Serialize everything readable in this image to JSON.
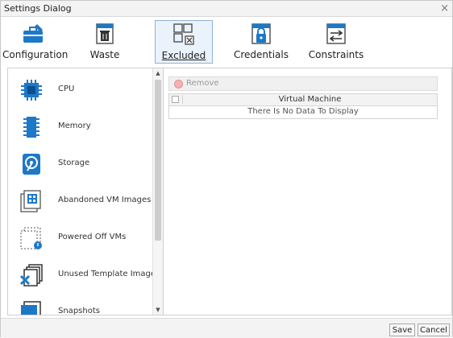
{
  "window": {
    "title": "Settings Dialog",
    "close_glyph": "×"
  },
  "toolbar": {
    "tabs": [
      {
        "label": "Configuration",
        "icon": "toolbox-icon"
      },
      {
        "label": "Waste",
        "icon": "trash-icon"
      },
      {
        "label": "Excluded",
        "icon": "excluded-grid-icon",
        "selected": true
      },
      {
        "label": "Credentials",
        "icon": "lock-icon"
      },
      {
        "label": "Constraints",
        "icon": "arrows-icon"
      }
    ]
  },
  "sidebar": {
    "items": [
      {
        "label": "CPU",
        "icon": "cpu-icon"
      },
      {
        "label": "Memory",
        "icon": "memory-icon"
      },
      {
        "label": "Storage",
        "icon": "storage-icon"
      },
      {
        "label": "Abandoned VM Images",
        "icon": "abandoned-images-icon"
      },
      {
        "label": "Powered Off VMs",
        "icon": "powered-off-icon"
      },
      {
        "label": "Unused Template Images",
        "icon": "unused-templates-icon"
      },
      {
        "label": "Snapshots",
        "icon": "snapshot-icon"
      }
    ]
  },
  "main": {
    "remove_label": "Remove",
    "grid": {
      "column": "Virtual Machine",
      "empty_text": "There Is No Data To Display"
    }
  },
  "footer": {
    "save_label": "Save",
    "cancel_label": "Cancel"
  },
  "colors": {
    "accent": "#1e78c8",
    "selected_bg": "#eaf2fb",
    "selected_border": "#8fb3d9"
  }
}
